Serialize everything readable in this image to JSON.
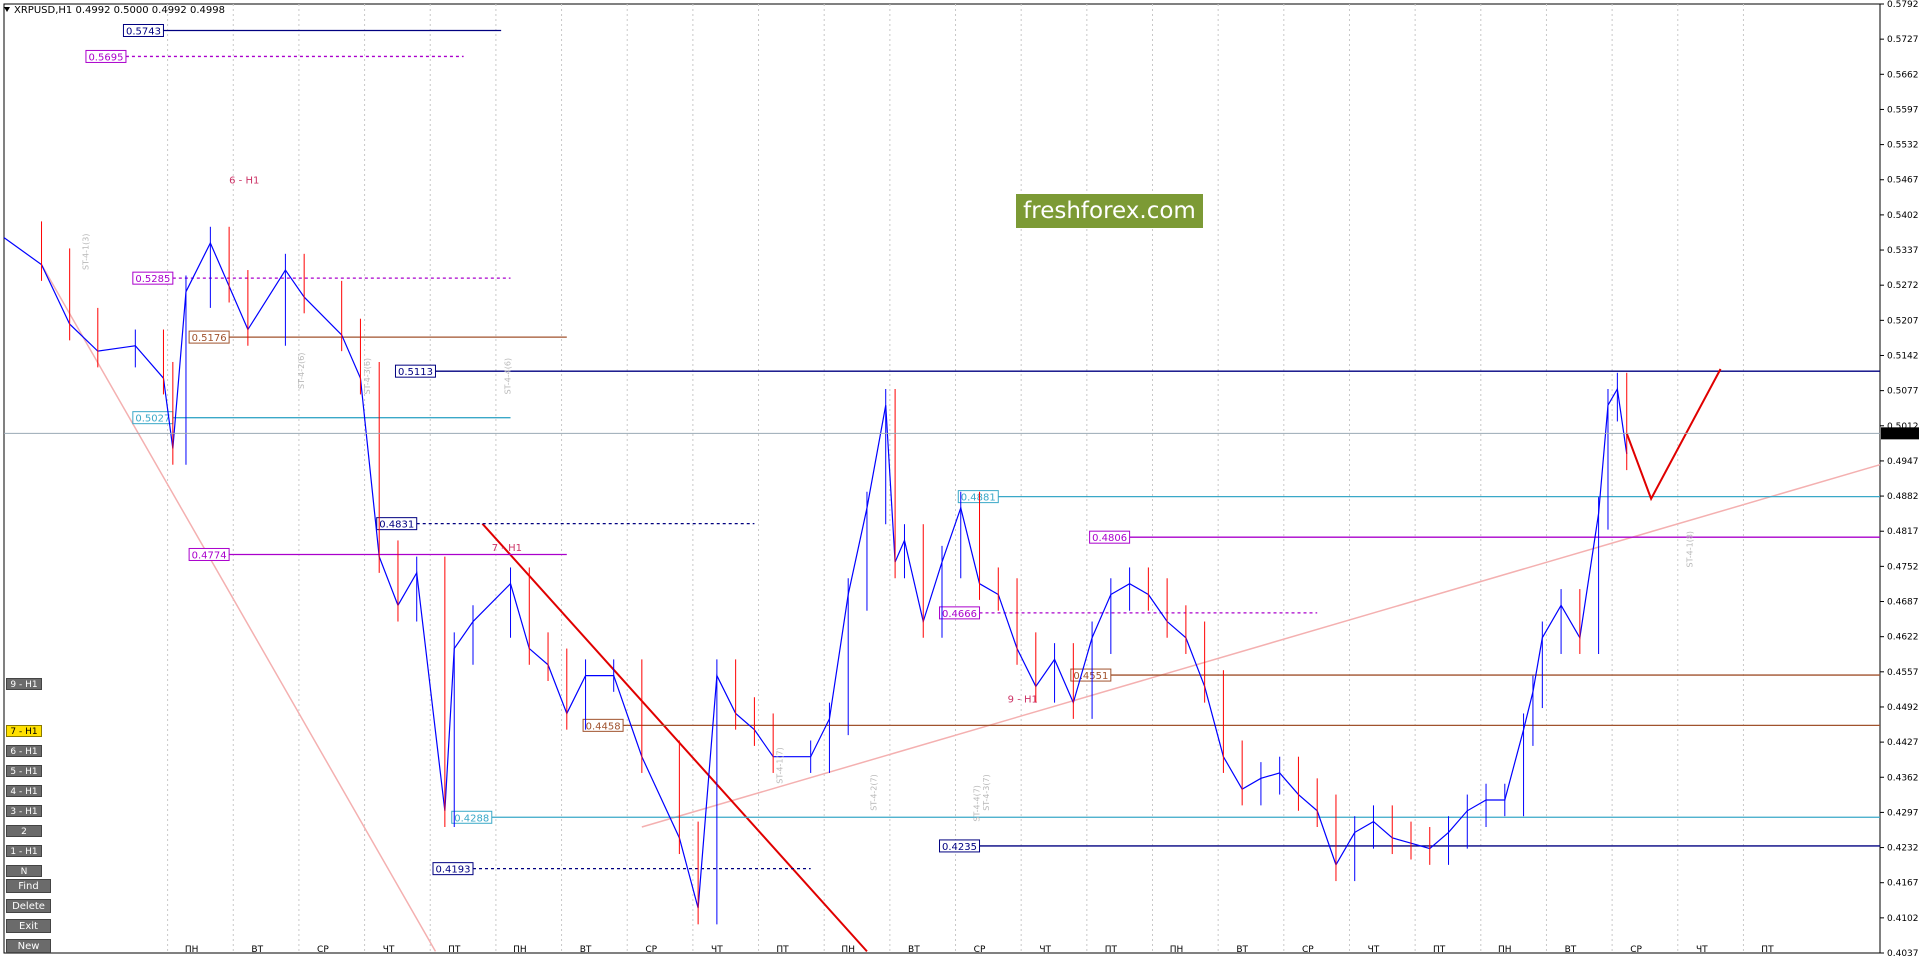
{
  "header": {
    "symbol": "XRPUSD,H1",
    "ohlc": "0.4992 0.5000 0.4992 0.4998"
  },
  "watermark": "freshforex.com",
  "panel": {
    "labels": [
      "9 - H1",
      "7 - H1",
      "6 - H1",
      "5 - H1",
      "4 - H1",
      "3 - H1",
      "2",
      "1 - H1",
      "N"
    ],
    "active": "7 - H1",
    "actions": [
      "Find",
      "Delete",
      "Exit",
      "New"
    ]
  },
  "colors": {
    "bull_candle": "#0000ff",
    "bear_candle": "#ff0000",
    "navy": "#000080",
    "purple": "#aa00cc",
    "brown": "#a0522d",
    "cyan": "#3aa8c8",
    "red": "#e00000",
    "pink": "#f4b0b0"
  },
  "chart_data": {
    "type": "line",
    "title": "XRPUSD,H1",
    "ylim": [
      0.4037,
      0.5792
    ],
    "y_ticks": [
      "0.5792",
      "0.5727",
      "0.5662",
      "0.5597",
      "0.5532",
      "0.5467",
      "0.5402",
      "0.5337",
      "0.5272",
      "0.5207",
      "0.5142",
      "0.5077",
      "0.5012",
      "0.4947",
      "0.4882",
      "0.4817",
      "0.4752",
      "0.4687",
      "0.4622",
      "0.4557",
      "0.4492",
      "0.4427",
      "0.4362",
      "0.4297",
      "0.4232",
      "0.4167",
      "0.4102",
      "0.4037"
    ],
    "x_labels": [
      "ПН",
      "ВТ",
      "СР",
      "ЧТ",
      "ПТ",
      "ПН",
      "ВТ",
      "СР",
      "ЧТ",
      "ПТ",
      "ПН",
      "ВТ",
      "СР",
      "ЧТ",
      "ПТ",
      "ПН",
      "ВТ",
      "СР",
      "ЧТ",
      "ПТ",
      "ПН",
      "ВТ",
      "СР",
      "ЧТ",
      "ПТ"
    ],
    "current_price": "0.4998",
    "price_path": [
      [
        0,
        0.536
      ],
      [
        0.02,
        0.531
      ],
      [
        0.035,
        0.52
      ],
      [
        0.05,
        0.515
      ],
      [
        0.07,
        0.516
      ],
      [
        0.085,
        0.51
      ],
      [
        0.09,
        0.497
      ],
      [
        0.097,
        0.526
      ],
      [
        0.11,
        0.535
      ],
      [
        0.12,
        0.527
      ],
      [
        0.13,
        0.519
      ],
      [
        0.15,
        0.53
      ],
      [
        0.16,
        0.525
      ],
      [
        0.18,
        0.518
      ],
      [
        0.19,
        0.51
      ],
      [
        0.2,
        0.477
      ],
      [
        0.21,
        0.468
      ],
      [
        0.22,
        0.474
      ],
      [
        0.235,
        0.43
      ],
      [
        0.24,
        0.46
      ],
      [
        0.25,
        0.465
      ],
      [
        0.27,
        0.472
      ],
      [
        0.28,
        0.46
      ],
      [
        0.29,
        0.457
      ],
      [
        0.3,
        0.448
      ],
      [
        0.31,
        0.455
      ],
      [
        0.325,
        0.455
      ],
      [
        0.34,
        0.44
      ],
      [
        0.36,
        0.425
      ],
      [
        0.37,
        0.412
      ],
      [
        0.38,
        0.455
      ],
      [
        0.39,
        0.448
      ],
      [
        0.4,
        0.445
      ],
      [
        0.41,
        0.44
      ],
      [
        0.43,
        0.44
      ],
      [
        0.44,
        0.447
      ],
      [
        0.45,
        0.47
      ],
      [
        0.46,
        0.486
      ],
      [
        0.47,
        0.505
      ],
      [
        0.475,
        0.476
      ],
      [
        0.48,
        0.48
      ],
      [
        0.49,
        0.465
      ],
      [
        0.5,
        0.476
      ],
      [
        0.51,
        0.486
      ],
      [
        0.52,
        0.472
      ],
      [
        0.53,
        0.47
      ],
      [
        0.54,
        0.46
      ],
      [
        0.55,
        0.453
      ],
      [
        0.56,
        0.458
      ],
      [
        0.57,
        0.45
      ],
      [
        0.58,
        0.462
      ],
      [
        0.59,
        0.47
      ],
      [
        0.6,
        0.472
      ],
      [
        0.61,
        0.47
      ],
      [
        0.62,
        0.465
      ],
      [
        0.63,
        0.462
      ],
      [
        0.64,
        0.453
      ],
      [
        0.65,
        0.44
      ],
      [
        0.66,
        0.434
      ],
      [
        0.67,
        0.436
      ],
      [
        0.68,
        0.437
      ],
      [
        0.69,
        0.433
      ],
      [
        0.7,
        0.43
      ],
      [
        0.71,
        0.42
      ],
      [
        0.72,
        0.426
      ],
      [
        0.73,
        0.428
      ],
      [
        0.74,
        0.425
      ],
      [
        0.75,
        0.424
      ],
      [
        0.76,
        0.423
      ],
      [
        0.77,
        0.426
      ],
      [
        0.78,
        0.43
      ],
      [
        0.79,
        0.432
      ],
      [
        0.8,
        0.432
      ],
      [
        0.81,
        0.445
      ],
      [
        0.815,
        0.452
      ],
      [
        0.82,
        0.462
      ],
      [
        0.83,
        0.468
      ],
      [
        0.84,
        0.462
      ],
      [
        0.85,
        0.485
      ],
      [
        0.855,
        0.505
      ],
      [
        0.86,
        0.508
      ],
      [
        0.865,
        0.496
      ]
    ],
    "projection": [
      [
        0.865,
        0.4998
      ],
      [
        0.878,
        0.4877
      ],
      [
        0.915,
        0.5117
      ]
    ],
    "levels": [
      {
        "label": "0.5743",
        "value": 0.5743,
        "color": "navy"
      },
      {
        "label": "0.5695",
        "value": 0.5695,
        "color": "purple"
      },
      {
        "label": "0.5285",
        "value": 0.5285,
        "color": "purple"
      },
      {
        "label": "0.5176",
        "value": 0.5176,
        "color": "brown"
      },
      {
        "label": "0.5113",
        "value": 0.5113,
        "color": "navy"
      },
      {
        "label": "0.5027",
        "value": 0.5027,
        "color": "cyan"
      },
      {
        "label": "0.4831",
        "value": 0.4831,
        "color": "navy"
      },
      {
        "label": "0.4774",
        "value": 0.4774,
        "color": "purple"
      },
      {
        "label": "0.4881",
        "value": 0.4881,
        "color": "cyan"
      },
      {
        "label": "0.4806",
        "value": 0.4806,
        "color": "purple"
      },
      {
        "label": "0.4666",
        "value": 0.4666,
        "color": "purple"
      },
      {
        "label": "0.4551",
        "value": 0.4551,
        "color": "brown"
      },
      {
        "label": "0.4458",
        "value": 0.4458,
        "color": "brown"
      },
      {
        "label": "0.4288",
        "value": 0.4288,
        "color": "cyan"
      },
      {
        "label": "0.4235",
        "value": 0.4235,
        "color": "navy"
      },
      {
        "label": "0.4193",
        "value": 0.4193,
        "color": "navy"
      }
    ],
    "markers": [
      "6 - H1",
      "7 - H1",
      "9 - H1"
    ],
    "st_labels": [
      "ST-4-1(3)",
      "ST-4-2(6)",
      "ST-4-3(6)",
      "ST-4-4(6)",
      "ST-4-1(7)",
      "ST-4-2(7)",
      "ST-4-3(7)",
      "ST-4-4(7)",
      "ST-4-1(8)"
    ]
  }
}
